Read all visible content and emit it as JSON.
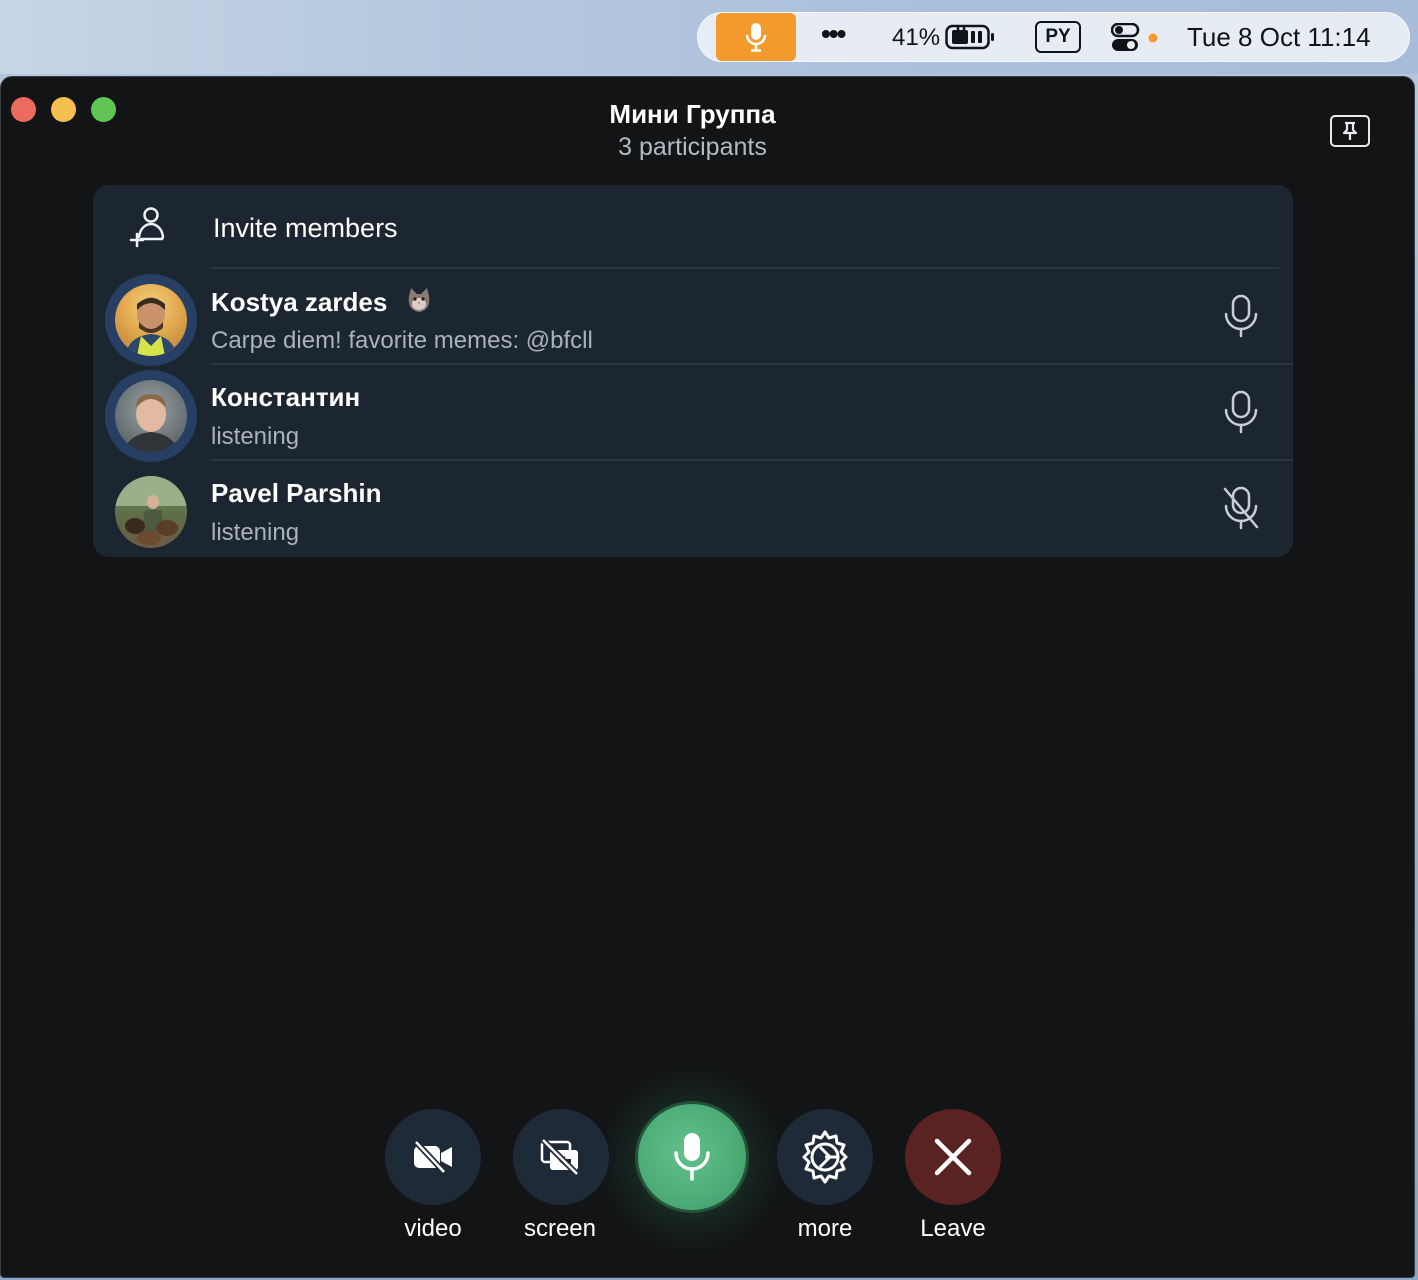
{
  "menubar": {
    "battery_percent": "41%",
    "input_language": "PY",
    "datetime": "Tue 8 Oct  11:14",
    "colors": {
      "mic_indicator": "#f29a2e"
    },
    "icons": [
      "microphone-icon",
      "more-dots-icon",
      "battery-charging-icon",
      "input-source-icon",
      "control-center-icon"
    ]
  },
  "window": {
    "title": "Мини Группа",
    "subtitle": "3 participants",
    "invite_label": "Invite members",
    "members": [
      {
        "name": "Kostya zardes",
        "status": "Carpe diem! favorite memes: @bfcll",
        "mic": "on",
        "speaking_ring": true
      },
      {
        "name": "Константин",
        "status": "listening",
        "mic": "on",
        "speaking_ring": true
      },
      {
        "name": "Pavel Parshin",
        "status": "listening",
        "mic": "muted",
        "speaking_ring": false
      }
    ]
  },
  "controls": {
    "video_label": "video",
    "screen_label": "screen",
    "more_label": "more",
    "leave_label": "Leave",
    "colors": {
      "mic_active": "#4fae78",
      "leave": "#5a2322",
      "button_bg": "#1f2a38"
    }
  }
}
